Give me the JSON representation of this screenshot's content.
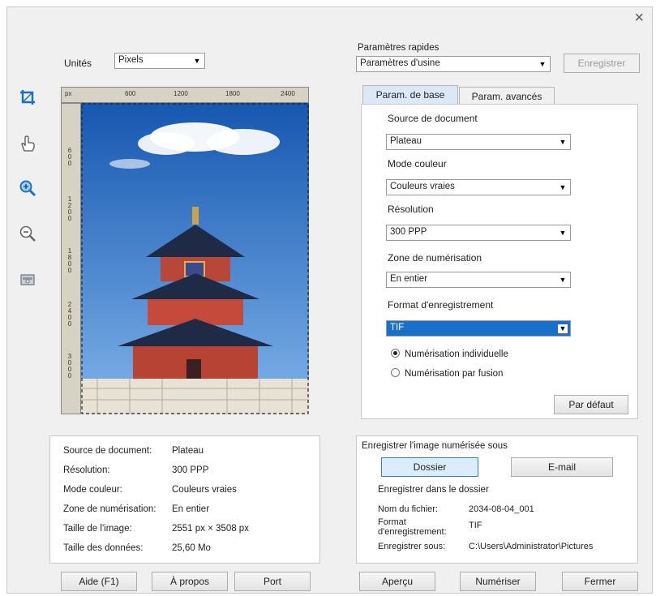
{
  "window": {
    "close_glyph": "×"
  },
  "units": {
    "label": "Unités",
    "value": "Pixels"
  },
  "quick_settings": {
    "label": "Paramètres rapides",
    "value": "Paramètres d'usine",
    "save_label": "Enregistrer"
  },
  "ruler": {
    "unit": "px",
    "h_ticks": [
      "600",
      "1200",
      "1800",
      "2400"
    ],
    "v_ticks": [
      [
        "6",
        "0",
        "0"
      ],
      [
        "1",
        "2",
        "0",
        "0"
      ],
      [
        "1",
        "8",
        "0",
        "0"
      ],
      [
        "2",
        "4",
        "0",
        "0"
      ],
      [
        "3",
        "0",
        "0",
        "0"
      ]
    ]
  },
  "tabs": [
    {
      "label": "Param. de base"
    },
    {
      "label": "Param. avancés"
    }
  ],
  "basic": {
    "source_label": "Source de document",
    "source_value": "Plateau",
    "color_label": "Mode couleur",
    "color_value": "Couleurs vraies",
    "resolution_label": "Résolution",
    "resolution_value": "300 PPP",
    "zone_label": "Zone de numérisation",
    "zone_value": "En entier",
    "format_label": "Format d'enregistrement",
    "format_value": "TIF",
    "radio_single": "Numérisation individuelle",
    "radio_merge": "Numérisation par fusion",
    "default_btn": "Par défaut"
  },
  "info": {
    "rows": [
      {
        "label": "Source de document:",
        "value": "Plateau"
      },
      {
        "label": "Résolution:",
        "value": "300 PPP"
      },
      {
        "label": "Mode couleur:",
        "value": "Couleurs vraies"
      },
      {
        "label": "Zone de numérisation:",
        "value": "En entier"
      },
      {
        "label": "Taille de l'image:",
        "value": "2551 px × 3508 px"
      },
      {
        "label": "Taille des données:",
        "value": "25,60 Mo"
      }
    ]
  },
  "save": {
    "title": "Enregistrer l'image numérisée sous",
    "folder_btn": "Dossier",
    "email_btn": "E-mail",
    "in_folder_label": "Enregistrer dans le dossier",
    "filename_label": "Nom du fichier:",
    "filename_value": "2034-08-04_001",
    "format_label": "Format d'enregistrement:",
    "format_value": "TIF",
    "path_label": "Enregistrer sous:",
    "path_value": "C:\\Users\\Administrator\\Pictures"
  },
  "footer": {
    "help": "Aide (F1)",
    "about": "À propos",
    "port": "Port",
    "preview": "Aperçu",
    "scan": "Numériser",
    "close": "Fermer"
  },
  "colors": {
    "accent": "#1a6fc8",
    "tab_active": "#dbe9f7",
    "sky_top": "#1657b0",
    "sky_bottom": "#7fb3ea"
  }
}
